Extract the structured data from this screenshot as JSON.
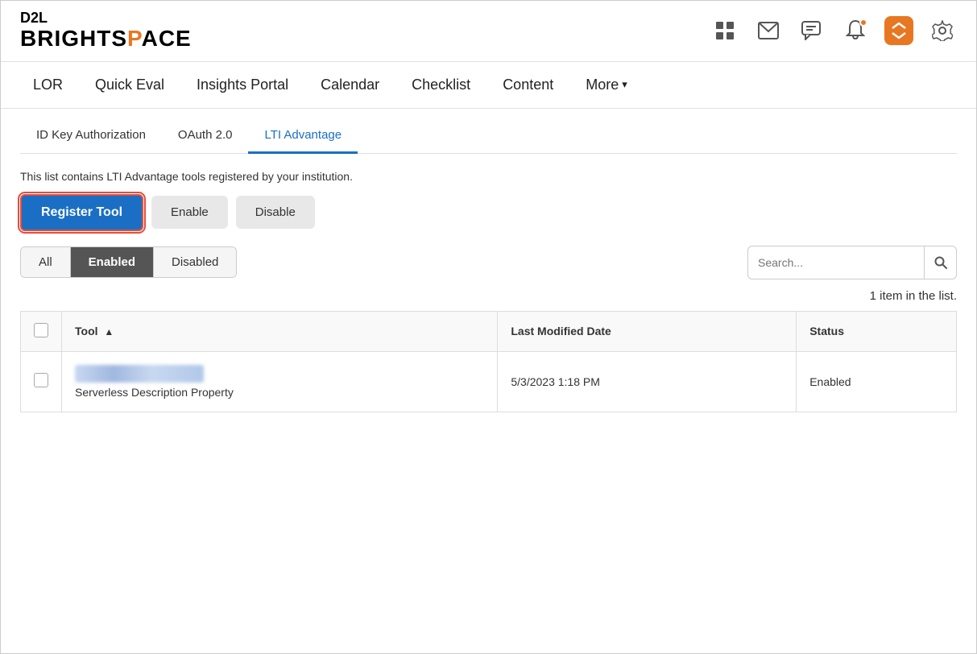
{
  "app": {
    "logo_d2l": "D2L",
    "logo_brightspace_pre": "BRIGHTS",
    "logo_brightspace_accent": "P",
    "logo_brightspace_post": "ACE"
  },
  "header": {
    "icons": [
      {
        "name": "grid-icon",
        "symbol": "⊞",
        "label": "Apps"
      },
      {
        "name": "mail-icon",
        "symbol": "✉",
        "label": "Email"
      },
      {
        "name": "chat-icon",
        "symbol": "💬",
        "label": "Chat"
      },
      {
        "name": "bell-icon",
        "symbol": "🔔",
        "label": "Notifications",
        "has_dot": true
      },
      {
        "name": "switch-icon",
        "symbol": "⇌",
        "label": "Switch",
        "orange": true
      },
      {
        "name": "gear-icon",
        "symbol": "⚙",
        "label": "Settings"
      }
    ]
  },
  "nav": {
    "items": [
      {
        "label": "LOR",
        "active": false
      },
      {
        "label": "Quick Eval",
        "active": false
      },
      {
        "label": "Insights Portal",
        "active": false
      },
      {
        "label": "Calendar",
        "active": false
      },
      {
        "label": "Checklist",
        "active": false
      },
      {
        "label": "Content",
        "active": false
      },
      {
        "label": "More",
        "active": false,
        "has_chevron": true
      }
    ]
  },
  "tabs": {
    "items": [
      {
        "label": "ID Key Authorization",
        "active": false
      },
      {
        "label": "OAuth 2.0",
        "active": false
      },
      {
        "label": "LTI Advantage",
        "active": true
      }
    ]
  },
  "main": {
    "description": "This list contains LTI Advantage tools registered by your institution.",
    "buttons": {
      "register": "Register Tool",
      "enable": "Enable",
      "disable": "Disable"
    },
    "filter_tabs": [
      {
        "label": "All",
        "active": false
      },
      {
        "label": "Enabled",
        "active": true
      },
      {
        "label": "Disabled",
        "active": false
      }
    ],
    "search": {
      "placeholder": "Search..."
    },
    "item_count": "1 item in the list.",
    "table": {
      "columns": [
        {
          "label": "",
          "type": "checkbox"
        },
        {
          "label": "Tool",
          "sortable": true
        },
        {
          "label": "Last Modified Date"
        },
        {
          "label": "Status"
        }
      ],
      "rows": [
        {
          "tool_name": "Serverless Description Property",
          "last_modified": "5/3/2023 1:18 PM",
          "status": "Enabled"
        }
      ]
    }
  }
}
